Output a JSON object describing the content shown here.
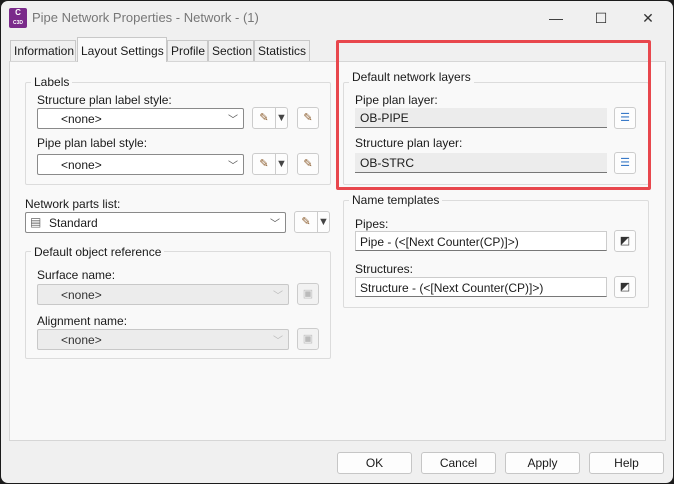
{
  "window": {
    "title": "Pipe Network Properties - Network - (1)",
    "app_badge": "C",
    "app_badge_sub": "C3D",
    "minimize": "—",
    "maximize": "☐",
    "close": "✕"
  },
  "tabs": [
    {
      "label": "Information"
    },
    {
      "label": "Layout Settings",
      "active": true
    },
    {
      "label": "Profile"
    },
    {
      "label": "Section"
    },
    {
      "label": "Statistics"
    }
  ],
  "labels_group": {
    "title": "Labels",
    "structure_label": "Structure plan label style:",
    "structure_value": "<none>",
    "pipe_label": "Pipe plan label style:",
    "pipe_value": "<none>"
  },
  "parts_list": {
    "label": "Network parts list:",
    "value": "Standard"
  },
  "object_ref": {
    "title": "Default object reference",
    "surface_label": "Surface name:",
    "surface_value": "<none>",
    "alignment_label": "Alignment name:",
    "alignment_value": "<none>"
  },
  "layers": {
    "title": "Default network layers",
    "pipe_label": "Pipe plan layer:",
    "pipe_value": "OB-PIPE",
    "structure_label": "Structure plan layer:",
    "structure_value": "OB-STRC"
  },
  "name_templates": {
    "title": "Name templates",
    "pipes_label": "Pipes:",
    "pipes_value": "Pipe - (<[Next Counter(CP)]>)",
    "structures_label": "Structures:",
    "structures_value": "Structure - (<[Next Counter(CP)]>)"
  },
  "buttons": {
    "ok": "OK",
    "cancel": "Cancel",
    "apply": "Apply",
    "help": "Help"
  },
  "colors": {
    "highlight": "#e8474d",
    "app_icon": "#7a2a8a"
  }
}
